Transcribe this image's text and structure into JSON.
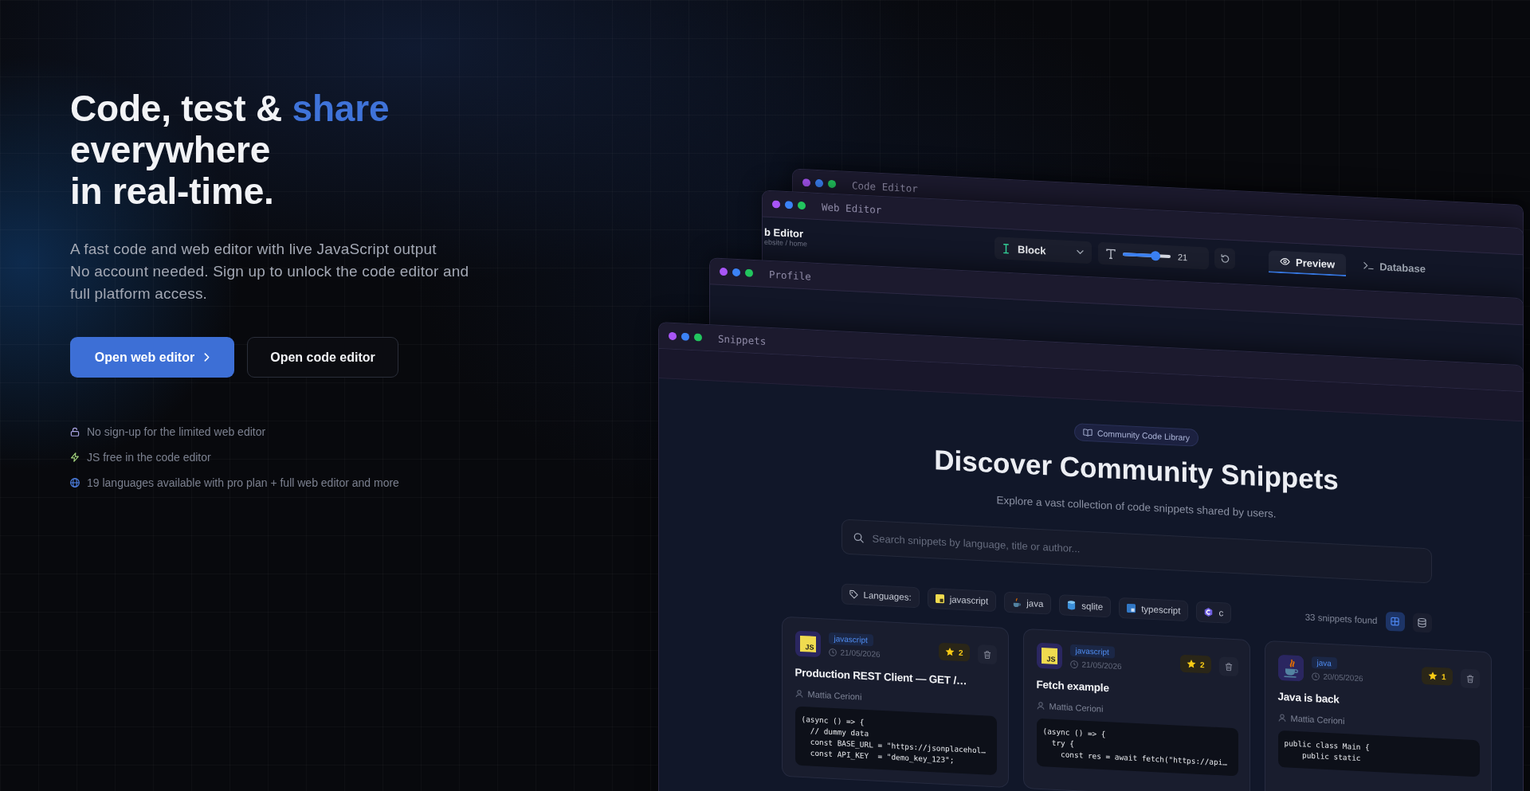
{
  "hero": {
    "title_lines": [
      [
        {
          "text": "Code, test & ",
          "accent": false
        },
        {
          "text": "share",
          "accent": true
        }
      ],
      [
        {
          "text": "everywhere",
          "accent": false
        }
      ],
      [
        {
          "text": "in real-time.",
          "accent": false
        }
      ]
    ],
    "paragraphs": [
      "A fast code and web editor with live JavaScript output",
      "No account needed. Sign up to unlock the code editor and full platform access."
    ],
    "buttons": [
      {
        "label": "Open web editor",
        "kind": "primary"
      },
      {
        "label": "Open code editor",
        "kind": "secondary"
      }
    ],
    "features": [
      {
        "kind": "lock",
        "text": "No sign-up for the limited web editor"
      },
      {
        "kind": "bolt",
        "text": "JS free in the code editor"
      },
      {
        "kind": "globe",
        "text": "19 languages available with pro plan + full web editor and more"
      }
    ]
  },
  "windows": [
    {
      "kind": "blank",
      "title": "Code Editor"
    },
    {
      "kind": "web_editor",
      "title": "Web Editor",
      "heading": "b Editor",
      "breadcrumb": "ebsite / home",
      "block_select": {
        "value": "Block"
      },
      "font_size": {
        "level": 0.68,
        "reading": "21"
      },
      "tabs": [
        {
          "label": "Preview",
          "kind": "eye",
          "selected": true
        },
        {
          "label": "Database",
          "kind": "terminal",
          "selected": false
        }
      ]
    },
    {
      "kind": "blank",
      "title": "Profile"
    },
    {
      "kind": "snippets",
      "title": "Snippets",
      "badge": "Community Code Library",
      "heading": "Discover Community Snippets",
      "subtitle": "Explore a vast collection of code snippets shared by users.",
      "search": {
        "placeholder": "Search snippets by language, title or author..."
      },
      "filter_label": "Languages:",
      "languages": [
        {
          "label": "javascript",
          "kind": "js",
          "selected": false
        },
        {
          "label": "java",
          "kind": "java",
          "selected": false
        },
        {
          "label": "sqlite",
          "kind": "sqlite",
          "selected": false
        },
        {
          "label": "typescript",
          "kind": "ts",
          "selected": false
        },
        {
          "label": "c",
          "kind": "c",
          "selected": false
        }
      ],
      "count": "33 snippets found",
      "view_toggles": [
        {
          "kind": "grid",
          "selected": true
        },
        {
          "kind": "stack",
          "selected": false
        }
      ],
      "cards": [
        {
          "kind": "js",
          "logo_text": "JS",
          "language": "javascript",
          "date": "21/05/2026",
          "star_count": "2",
          "title": "Production REST Client — GET /…",
          "author": "Mattia Cerioni",
          "code": [
            "(async () => {",
            "  // dummy data",
            "  const BASE_URL = \"https://jsonplacehol…",
            "  const API_KEY  = \"demo_key_123\";"
          ]
        },
        {
          "kind": "js",
          "logo_text": "JS",
          "language": "javascript",
          "date": "21/05/2026",
          "star_count": "2",
          "title": "Fetch example",
          "author": "Mattia Cerioni",
          "code": [
            "(async () => {",
            "  try {",
            "    const res = await fetch(\"https://api…"
          ]
        },
        {
          "kind": "java",
          "language": "java",
          "date": "20/05/2026",
          "star_count": "1",
          "title": "Java is back",
          "author": "Mattia Cerioni",
          "code": [
            "public class Main {",
            "    public static"
          ]
        }
      ]
    }
  ]
}
